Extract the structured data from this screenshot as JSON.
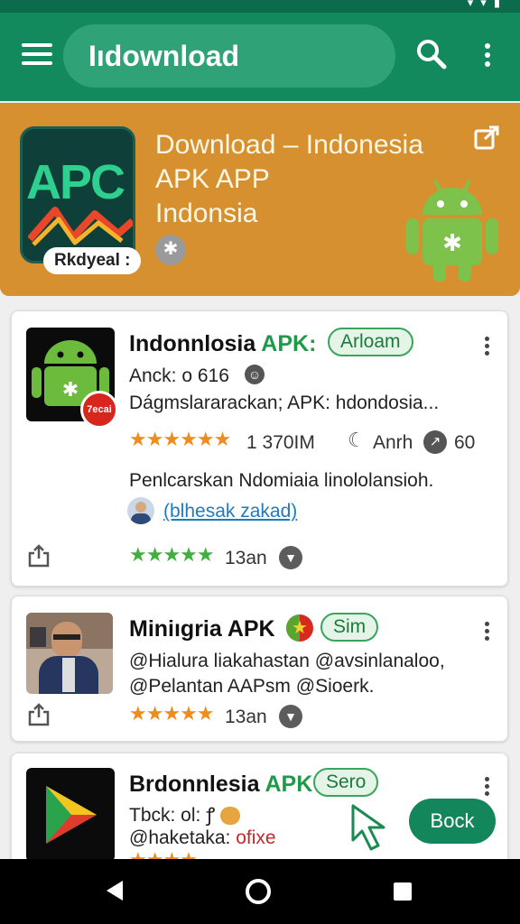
{
  "app_bar": {
    "search_label": "Iıdownload"
  },
  "banner": {
    "line1": "Download – Indonesia",
    "line2": "APK APP",
    "line3": "Indonsia",
    "logo_text": "APC",
    "badge": "Rkdyeal :"
  },
  "cards": [
    {
      "title": "Indonnlosia ",
      "title_apk": "APK:",
      "chip": "Arloam",
      "thumb_badge": "7ecai",
      "line1": "Anck: o 616",
      "line2": "Dágmslararackan; APK: hdondosia...",
      "rating_count": "1 370IM",
      "meta1": "Anrh",
      "meta2": "60",
      "description": "Penlcarskan Ndomiaia linololansioh.",
      "link": "(blhesak zakad)",
      "bottom_text": "13an"
    },
    {
      "title": "Miniıgria ",
      "title_apk": "APK",
      "chip": "Sim",
      "line1": "@Hialura liakahastan @avsinlanaloo,",
      "line2": "@Pelantan AAPsm @Sioerk.",
      "bottom_text": "13an"
    },
    {
      "title": "Brdonnlesia ",
      "title_apk": "APK",
      "chip": "Sero",
      "line1": "Tbck: ol: ꝭ",
      "line2": "@haketaka: ",
      "line2_red": "ofixe",
      "button": "Bock"
    }
  ],
  "colors": {
    "appbar": "#138a5e",
    "banner": "#d6902f",
    "accent_green": "#1f9a4b",
    "star_orange": "#f08c1b"
  },
  "icons": [
    "menu-icon",
    "search-icon",
    "kebab-icon",
    "open-external-icon",
    "android-icon",
    "share-icon",
    "chevron-down-icon",
    "back-icon",
    "home-icon",
    "recents-icon"
  ]
}
